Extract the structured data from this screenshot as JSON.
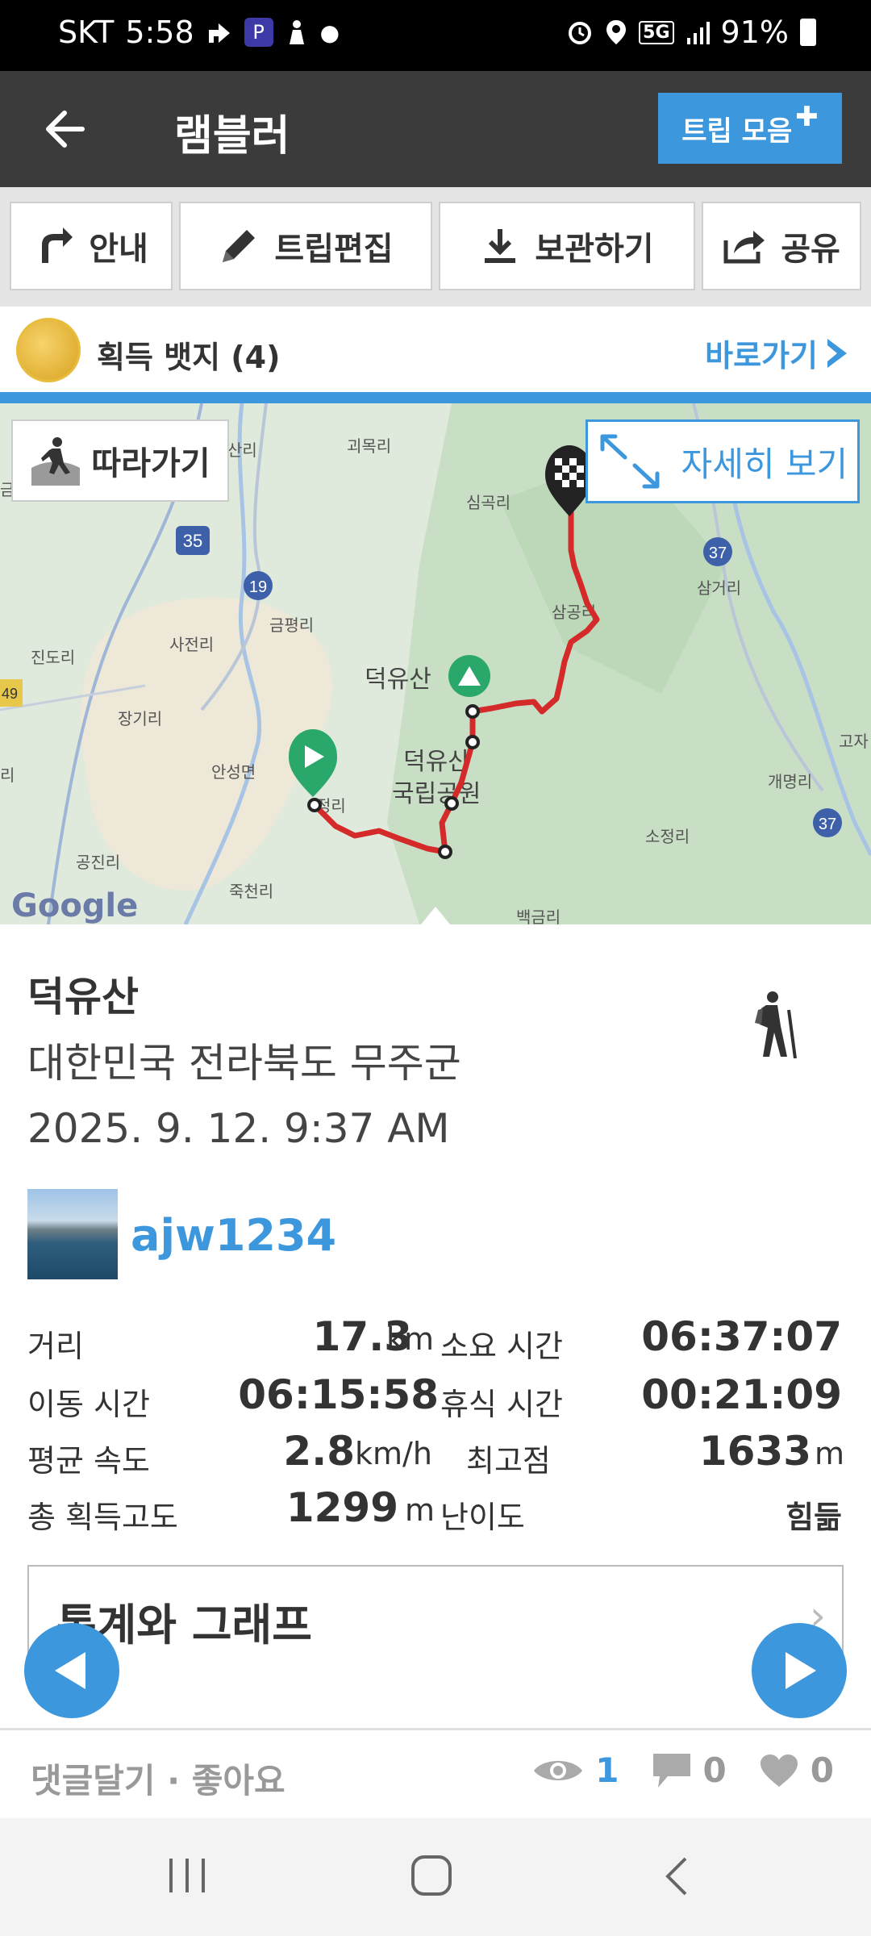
{
  "status_bar": {
    "carrier": "SKT",
    "time": "5:58",
    "battery": "91%",
    "network": "5G"
  },
  "header": {
    "title": "램블러",
    "trip_button_label": "트립 모음",
    "trip_button_icon": "plus-icon"
  },
  "toolbar": {
    "guide_label": "안내",
    "edit_label": "트립편집",
    "save_label": "보관하기",
    "share_label": "공유"
  },
  "badges": {
    "label": "획득 뱃지 (4)",
    "goto_label": "바로가기"
  },
  "map": {
    "follow_label": "따라가기",
    "detail_label": "자세히 보기",
    "google_label": "Google",
    "route_color": "#d42a2a",
    "labels": {
      "l1": "산리",
      "l2": "괴목리",
      "l3": "심곡리",
      "l4": "삼공리",
      "l5": "삼거리",
      "l6": "금평리",
      "l7": "사전리",
      "l8": "진도리",
      "l9": "장기리",
      "l10": "덕유산",
      "l11": "덕유산",
      "l12": "국립공원",
      "l13": "안성면",
      "l14": "정리",
      "l15": "개명리",
      "l16": "소정리",
      "l17": "공진리",
      "l18": "죽천리",
      "l19": "고자",
      "l20": "백금리",
      "l21": "리",
      "l22": "금부리"
    },
    "route_shields": {
      "s35": "35",
      "s19": "19",
      "s37a": "37",
      "s37b": "37",
      "s49": "49"
    }
  },
  "trip": {
    "place": "덕유산",
    "region": "대한민국 전라북도 무주군",
    "date": "2025. 9. 12. 9:37 AM",
    "username": "ajw1234",
    "activity_icon": "hiking-icon"
  },
  "stats": {
    "distance_label": "거리",
    "distance_value": "17.3",
    "distance_unit": "km",
    "duration_label": "소요 시간",
    "duration_value": "06:37:07",
    "moving_label": "이동 시간",
    "moving_value": "06:15:58",
    "rest_label": "휴식 시간",
    "rest_value": "00:21:09",
    "avg_speed_label": "평균 속도",
    "avg_speed_value": "2.8",
    "avg_speed_unit": "km/h",
    "max_elev_label": "최고점",
    "max_elev_value": "1633",
    "max_elev_unit": "m",
    "total_gain_label": "총 획득고도",
    "total_gain_value": "1299",
    "total_gain_unit": "m",
    "difficulty_label": "난이도",
    "difficulty_value": "힘듦"
  },
  "graph": {
    "title": "통계와 그래프"
  },
  "footer": {
    "comments_label": "댓글달기 · 좋아요",
    "views": "1",
    "comments": "0",
    "likes": "0"
  },
  "colors": {
    "accent": "#3d97dd",
    "header_bg": "#3b3b3b",
    "route": "#d42a2a"
  }
}
